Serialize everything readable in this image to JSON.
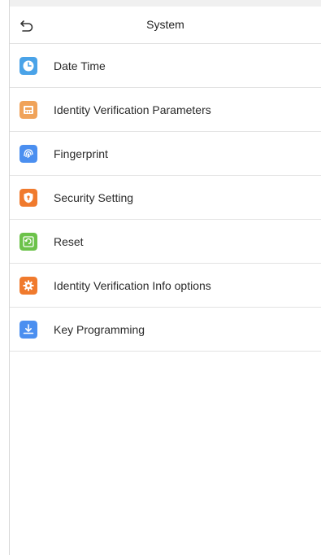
{
  "header": {
    "title": "System",
    "back_icon": "back-arrow-icon"
  },
  "menu": {
    "items": [
      {
        "label": "Date Time",
        "icon": "clock-icon",
        "color": "#4aa3e8"
      },
      {
        "label": "Identity Verification Parameters",
        "icon": "terminal-icon",
        "color": "#f0a35a"
      },
      {
        "label": "Fingerprint",
        "icon": "fingerprint-icon",
        "color": "#4b8ff0"
      },
      {
        "label": "Security Setting",
        "icon": "shield-icon",
        "color": "#f07a2d"
      },
      {
        "label": "Reset",
        "icon": "reset-icon",
        "color": "#6cc24a"
      },
      {
        "label": "Identity Verification Info options",
        "icon": "gear-icon",
        "color": "#f07a2d"
      },
      {
        "label": "Key Programming",
        "icon": "download-icon",
        "color": "#4b8ff0"
      }
    ]
  }
}
